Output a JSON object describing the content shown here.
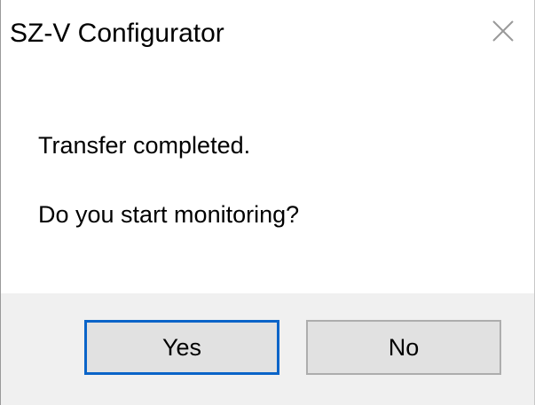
{
  "window": {
    "title": "SZ-V Configurator",
    "close_icon": "close-icon"
  },
  "message": {
    "line1": "Transfer completed.",
    "line2": "Do you start monitoring?"
  },
  "buttons": {
    "yes_label": "Yes",
    "no_label": "No",
    "default_focus_color": "#0a64c8"
  }
}
